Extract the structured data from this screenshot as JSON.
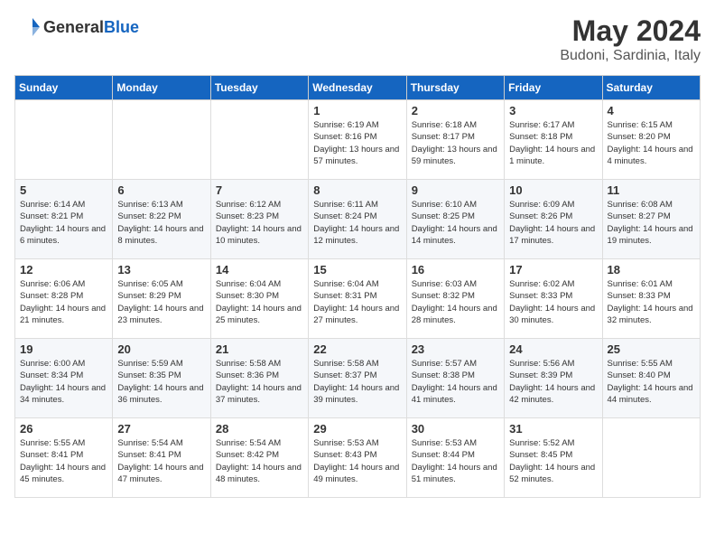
{
  "header": {
    "logo_general": "General",
    "logo_blue": "Blue",
    "month": "May 2024",
    "location": "Budoni, Sardinia, Italy"
  },
  "days_of_week": [
    "Sunday",
    "Monday",
    "Tuesday",
    "Wednesday",
    "Thursday",
    "Friday",
    "Saturday"
  ],
  "weeks": [
    [
      {
        "day": "",
        "sunrise": "",
        "sunset": "",
        "daylight": ""
      },
      {
        "day": "",
        "sunrise": "",
        "sunset": "",
        "daylight": ""
      },
      {
        "day": "",
        "sunrise": "",
        "sunset": "",
        "daylight": ""
      },
      {
        "day": "1",
        "sunrise": "Sunrise: 6:19 AM",
        "sunset": "Sunset: 8:16 PM",
        "daylight": "Daylight: 13 hours and 57 minutes."
      },
      {
        "day": "2",
        "sunrise": "Sunrise: 6:18 AM",
        "sunset": "Sunset: 8:17 PM",
        "daylight": "Daylight: 13 hours and 59 minutes."
      },
      {
        "day": "3",
        "sunrise": "Sunrise: 6:17 AM",
        "sunset": "Sunset: 8:18 PM",
        "daylight": "Daylight: 14 hours and 1 minute."
      },
      {
        "day": "4",
        "sunrise": "Sunrise: 6:15 AM",
        "sunset": "Sunset: 8:20 PM",
        "daylight": "Daylight: 14 hours and 4 minutes."
      }
    ],
    [
      {
        "day": "5",
        "sunrise": "Sunrise: 6:14 AM",
        "sunset": "Sunset: 8:21 PM",
        "daylight": "Daylight: 14 hours and 6 minutes."
      },
      {
        "day": "6",
        "sunrise": "Sunrise: 6:13 AM",
        "sunset": "Sunset: 8:22 PM",
        "daylight": "Daylight: 14 hours and 8 minutes."
      },
      {
        "day": "7",
        "sunrise": "Sunrise: 6:12 AM",
        "sunset": "Sunset: 8:23 PM",
        "daylight": "Daylight: 14 hours and 10 minutes."
      },
      {
        "day": "8",
        "sunrise": "Sunrise: 6:11 AM",
        "sunset": "Sunset: 8:24 PM",
        "daylight": "Daylight: 14 hours and 12 minutes."
      },
      {
        "day": "9",
        "sunrise": "Sunrise: 6:10 AM",
        "sunset": "Sunset: 8:25 PM",
        "daylight": "Daylight: 14 hours and 14 minutes."
      },
      {
        "day": "10",
        "sunrise": "Sunrise: 6:09 AM",
        "sunset": "Sunset: 8:26 PM",
        "daylight": "Daylight: 14 hours and 17 minutes."
      },
      {
        "day": "11",
        "sunrise": "Sunrise: 6:08 AM",
        "sunset": "Sunset: 8:27 PM",
        "daylight": "Daylight: 14 hours and 19 minutes."
      }
    ],
    [
      {
        "day": "12",
        "sunrise": "Sunrise: 6:06 AM",
        "sunset": "Sunset: 8:28 PM",
        "daylight": "Daylight: 14 hours and 21 minutes."
      },
      {
        "day": "13",
        "sunrise": "Sunrise: 6:05 AM",
        "sunset": "Sunset: 8:29 PM",
        "daylight": "Daylight: 14 hours and 23 minutes."
      },
      {
        "day": "14",
        "sunrise": "Sunrise: 6:04 AM",
        "sunset": "Sunset: 8:30 PM",
        "daylight": "Daylight: 14 hours and 25 minutes."
      },
      {
        "day": "15",
        "sunrise": "Sunrise: 6:04 AM",
        "sunset": "Sunset: 8:31 PM",
        "daylight": "Daylight: 14 hours and 27 minutes."
      },
      {
        "day": "16",
        "sunrise": "Sunrise: 6:03 AM",
        "sunset": "Sunset: 8:32 PM",
        "daylight": "Daylight: 14 hours and 28 minutes."
      },
      {
        "day": "17",
        "sunrise": "Sunrise: 6:02 AM",
        "sunset": "Sunset: 8:33 PM",
        "daylight": "Daylight: 14 hours and 30 minutes."
      },
      {
        "day": "18",
        "sunrise": "Sunrise: 6:01 AM",
        "sunset": "Sunset: 8:33 PM",
        "daylight": "Daylight: 14 hours and 32 minutes."
      }
    ],
    [
      {
        "day": "19",
        "sunrise": "Sunrise: 6:00 AM",
        "sunset": "Sunset: 8:34 PM",
        "daylight": "Daylight: 14 hours and 34 minutes."
      },
      {
        "day": "20",
        "sunrise": "Sunrise: 5:59 AM",
        "sunset": "Sunset: 8:35 PM",
        "daylight": "Daylight: 14 hours and 36 minutes."
      },
      {
        "day": "21",
        "sunrise": "Sunrise: 5:58 AM",
        "sunset": "Sunset: 8:36 PM",
        "daylight": "Daylight: 14 hours and 37 minutes."
      },
      {
        "day": "22",
        "sunrise": "Sunrise: 5:58 AM",
        "sunset": "Sunset: 8:37 PM",
        "daylight": "Daylight: 14 hours and 39 minutes."
      },
      {
        "day": "23",
        "sunrise": "Sunrise: 5:57 AM",
        "sunset": "Sunset: 8:38 PM",
        "daylight": "Daylight: 14 hours and 41 minutes."
      },
      {
        "day": "24",
        "sunrise": "Sunrise: 5:56 AM",
        "sunset": "Sunset: 8:39 PM",
        "daylight": "Daylight: 14 hours and 42 minutes."
      },
      {
        "day": "25",
        "sunrise": "Sunrise: 5:55 AM",
        "sunset": "Sunset: 8:40 PM",
        "daylight": "Daylight: 14 hours and 44 minutes."
      }
    ],
    [
      {
        "day": "26",
        "sunrise": "Sunrise: 5:55 AM",
        "sunset": "Sunset: 8:41 PM",
        "daylight": "Daylight: 14 hours and 45 minutes."
      },
      {
        "day": "27",
        "sunrise": "Sunrise: 5:54 AM",
        "sunset": "Sunset: 8:41 PM",
        "daylight": "Daylight: 14 hours and 47 minutes."
      },
      {
        "day": "28",
        "sunrise": "Sunrise: 5:54 AM",
        "sunset": "Sunset: 8:42 PM",
        "daylight": "Daylight: 14 hours and 48 minutes."
      },
      {
        "day": "29",
        "sunrise": "Sunrise: 5:53 AM",
        "sunset": "Sunset: 8:43 PM",
        "daylight": "Daylight: 14 hours and 49 minutes."
      },
      {
        "day": "30",
        "sunrise": "Sunrise: 5:53 AM",
        "sunset": "Sunset: 8:44 PM",
        "daylight": "Daylight: 14 hours and 51 minutes."
      },
      {
        "day": "31",
        "sunrise": "Sunrise: 5:52 AM",
        "sunset": "Sunset: 8:45 PM",
        "daylight": "Daylight: 14 hours and 52 minutes."
      },
      {
        "day": "",
        "sunrise": "",
        "sunset": "",
        "daylight": ""
      }
    ]
  ]
}
